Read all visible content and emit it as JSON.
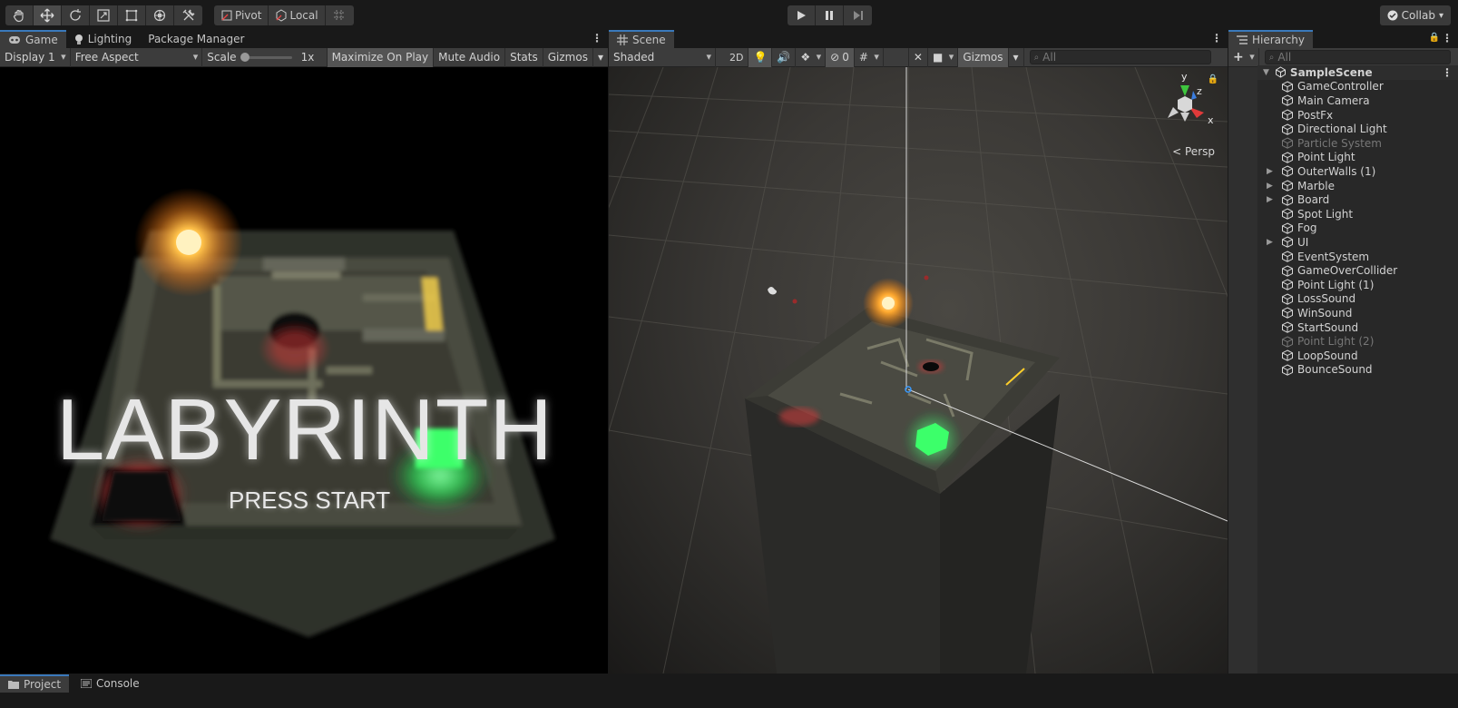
{
  "toolbar": {
    "tools": [
      "hand-icon",
      "move-icon",
      "rotate-icon",
      "scale-icon",
      "rect-icon",
      "transform-icon",
      "custom-tool-icon"
    ],
    "pivot_label": "Pivot",
    "local_label": "Local",
    "collab_label": "Collab"
  },
  "game_panel": {
    "tabs": [
      "Game",
      "Lighting",
      "Package Manager"
    ],
    "display": "Display 1",
    "aspect": "Free Aspect",
    "scale_label": "Scale",
    "scale_value": "1x",
    "maximize_label": "Maximize On Play",
    "mute_label": "Mute Audio",
    "stats_label": "Stats",
    "gizmos_label": "Gizmos",
    "title_text": "LABYRINTH",
    "subtitle_text": "PRESS START"
  },
  "scene_panel": {
    "tab": "Scene",
    "shading": "Shaded",
    "mode_2d": "2D",
    "hidden_count": "0",
    "gizmos_label": "Gizmos",
    "search_placeholder": "All",
    "persp_label": "Persp",
    "axes": {
      "y": "y",
      "z": "z",
      "x": "x"
    }
  },
  "hierarchy": {
    "tab": "Hierarchy",
    "add_label": "+",
    "search_placeholder": "All",
    "scene_name": "SampleScene",
    "items": [
      {
        "label": "GameController",
        "foldable": false,
        "dim": false
      },
      {
        "label": "Main Camera",
        "foldable": false,
        "dim": false
      },
      {
        "label": "PostFx",
        "foldable": false,
        "dim": false
      },
      {
        "label": "Directional Light",
        "foldable": false,
        "dim": false
      },
      {
        "label": "Particle System",
        "foldable": false,
        "dim": true
      },
      {
        "label": "Point Light",
        "foldable": false,
        "dim": false
      },
      {
        "label": "OuterWalls (1)",
        "foldable": true,
        "dim": false
      },
      {
        "label": "Marble",
        "foldable": true,
        "dim": false
      },
      {
        "label": "Board",
        "foldable": true,
        "dim": false
      },
      {
        "label": "Spot Light",
        "foldable": false,
        "dim": false
      },
      {
        "label": "Fog",
        "foldable": false,
        "dim": false
      },
      {
        "label": "UI",
        "foldable": true,
        "dim": false
      },
      {
        "label": "EventSystem",
        "foldable": false,
        "dim": false
      },
      {
        "label": "GameOverCollider",
        "foldable": false,
        "dim": false
      },
      {
        "label": "Point Light (1)",
        "foldable": false,
        "dim": false
      },
      {
        "label": "LossSound",
        "foldable": false,
        "dim": false
      },
      {
        "label": "WinSound",
        "foldable": false,
        "dim": false
      },
      {
        "label": "StartSound",
        "foldable": false,
        "dim": false
      },
      {
        "label": "Point Light (2)",
        "foldable": false,
        "dim": true
      },
      {
        "label": "LoopSound",
        "foldable": false,
        "dim": false
      },
      {
        "label": "BounceSound",
        "foldable": false,
        "dim": false
      }
    ]
  },
  "bottom_tabs": [
    "Project",
    "Console"
  ],
  "colors": {
    "accent": "#3a79bb",
    "panel": "#282828",
    "toolbar": "#191919",
    "green_goal": "#3cff6a",
    "red_hole": "#e23b3b",
    "marble_glow": "#ffb545"
  }
}
